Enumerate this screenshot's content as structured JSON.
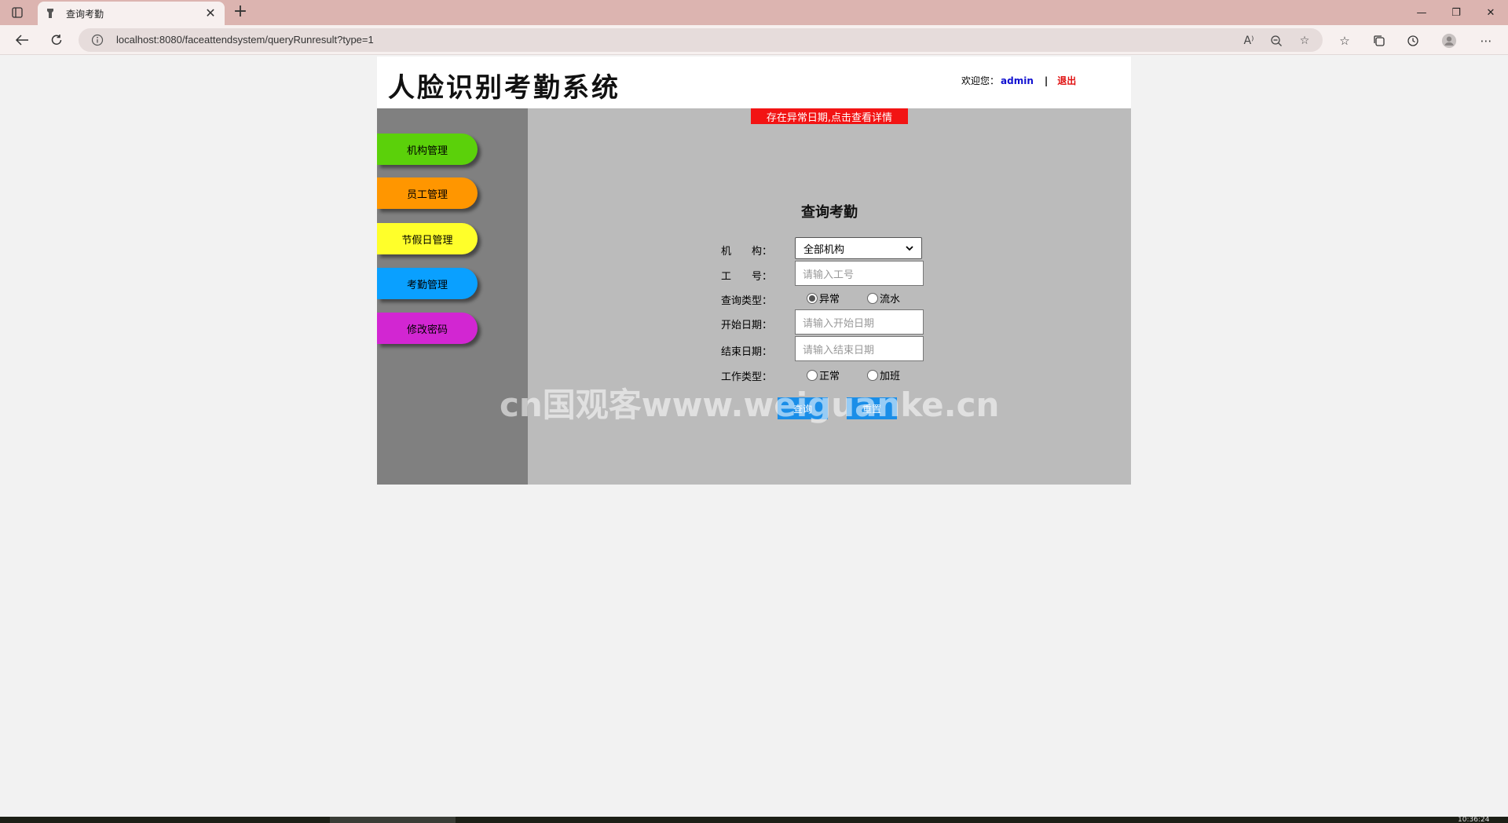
{
  "browser": {
    "tab_title": "查询考勤",
    "new_tab_symbol": "+",
    "url": "localhost:8080/faceattendsystem/queryRunresult?type=1"
  },
  "header": {
    "logo_text": "人脸识别考勤系统",
    "welcome_label": "欢迎您：",
    "username": "admin",
    "separator": "|",
    "logout_label": "退出"
  },
  "sidebar": {
    "items": [
      {
        "label": "机构管理",
        "color": "#5bd10a"
      },
      {
        "label": "员工管理",
        "color": "#ff9600"
      },
      {
        "label": "节假日管理",
        "color": "#ffff2a"
      },
      {
        "label": "考勤管理",
        "color": "#0aa0ff"
      },
      {
        "label": "修改密码",
        "color": "#d226d2"
      }
    ]
  },
  "main": {
    "alert_text": "存在异常日期,点击查看详情",
    "form_title": "查询考勤",
    "org_label": "机　　构：",
    "org_selected": "全部机构",
    "emp_label": "工　　号：",
    "emp_placeholder": "请输入工号",
    "query_type_label": "查询类型：",
    "query_type_options": [
      "异常",
      "流水"
    ],
    "query_type_selected": "异常",
    "start_label": "开始日期：",
    "start_placeholder": "请输入开始日期",
    "end_label": "结束日期：",
    "end_placeholder": "请输入结束日期",
    "work_type_label": "工作类型：",
    "work_type_options": [
      "正常",
      "加班"
    ],
    "submit_label": "查询",
    "reset_label": "重置"
  },
  "watermark_text": "cn国观客www.weiguanke.cn",
  "taskbar": {
    "clock": "10:36:24"
  }
}
